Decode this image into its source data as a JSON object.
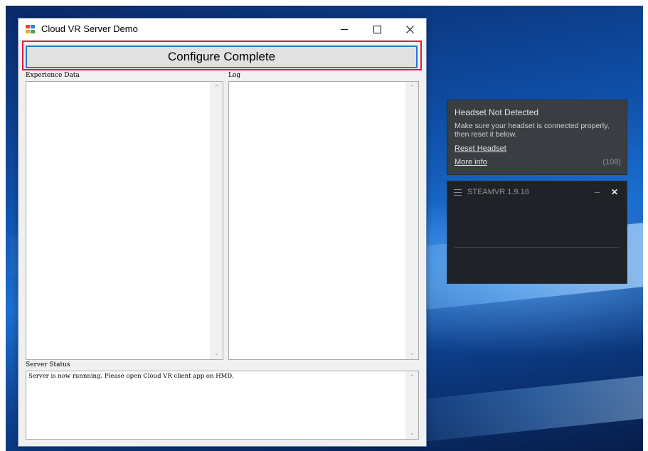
{
  "window": {
    "title": "Cloud VR Server Demo",
    "configure_button_label": "Configure Complete",
    "experience_label": "Experience Data",
    "log_label": "Log",
    "status_label": "Server Status",
    "status_text": "Server is now runnning. Please open Cloud VR client app on HMD.",
    "experience_text": "",
    "log_text": ""
  },
  "notification": {
    "title": "Headset Not Detected",
    "body": "Make sure your headset is connected properly, then reset it below.",
    "reset_link": "Reset Headset",
    "more_info_link": "More info",
    "count": "(108)"
  },
  "steamvr": {
    "title": "STEAMVR 1.9.16"
  },
  "colors": {
    "highlight_frame": "#e01b3c",
    "button_focus_border": "#1f79d1",
    "notification_bg": "#3a3d42",
    "steamvr_bg": "#1f2226"
  }
}
